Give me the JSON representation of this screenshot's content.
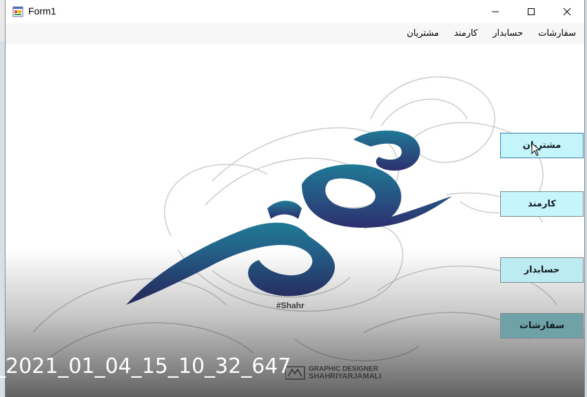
{
  "window": {
    "title": "Form1",
    "minimize_icon": "minimize-icon",
    "maximize_icon": "maximize-icon",
    "close_icon": "close-icon"
  },
  "menu": {
    "items": [
      {
        "label": "مشتریان"
      },
      {
        "label": "کارمند"
      },
      {
        "label": "حسابدار"
      },
      {
        "label": "سفارشات"
      }
    ]
  },
  "buttons": [
    {
      "label": "مشتریان"
    },
    {
      "label": "کارمند"
    },
    {
      "label": "حسابدار"
    },
    {
      "label": "سفارشات"
    }
  ],
  "artwork": {
    "hashtag": "#Shahr",
    "brand_line1": "GRAPHIC DESIGNER",
    "brand_line2": "SHAHRIYARJAMALI"
  },
  "overlay": {
    "stamp": "_2021_01_04_15_10_32_647"
  },
  "colors": {
    "calligraphy_top": "#1f7a96",
    "calligraphy_bottom": "#2d2f6e",
    "button_cyan": "#c4f5fb",
    "button_dark_teal": "#6fa2a6"
  }
}
